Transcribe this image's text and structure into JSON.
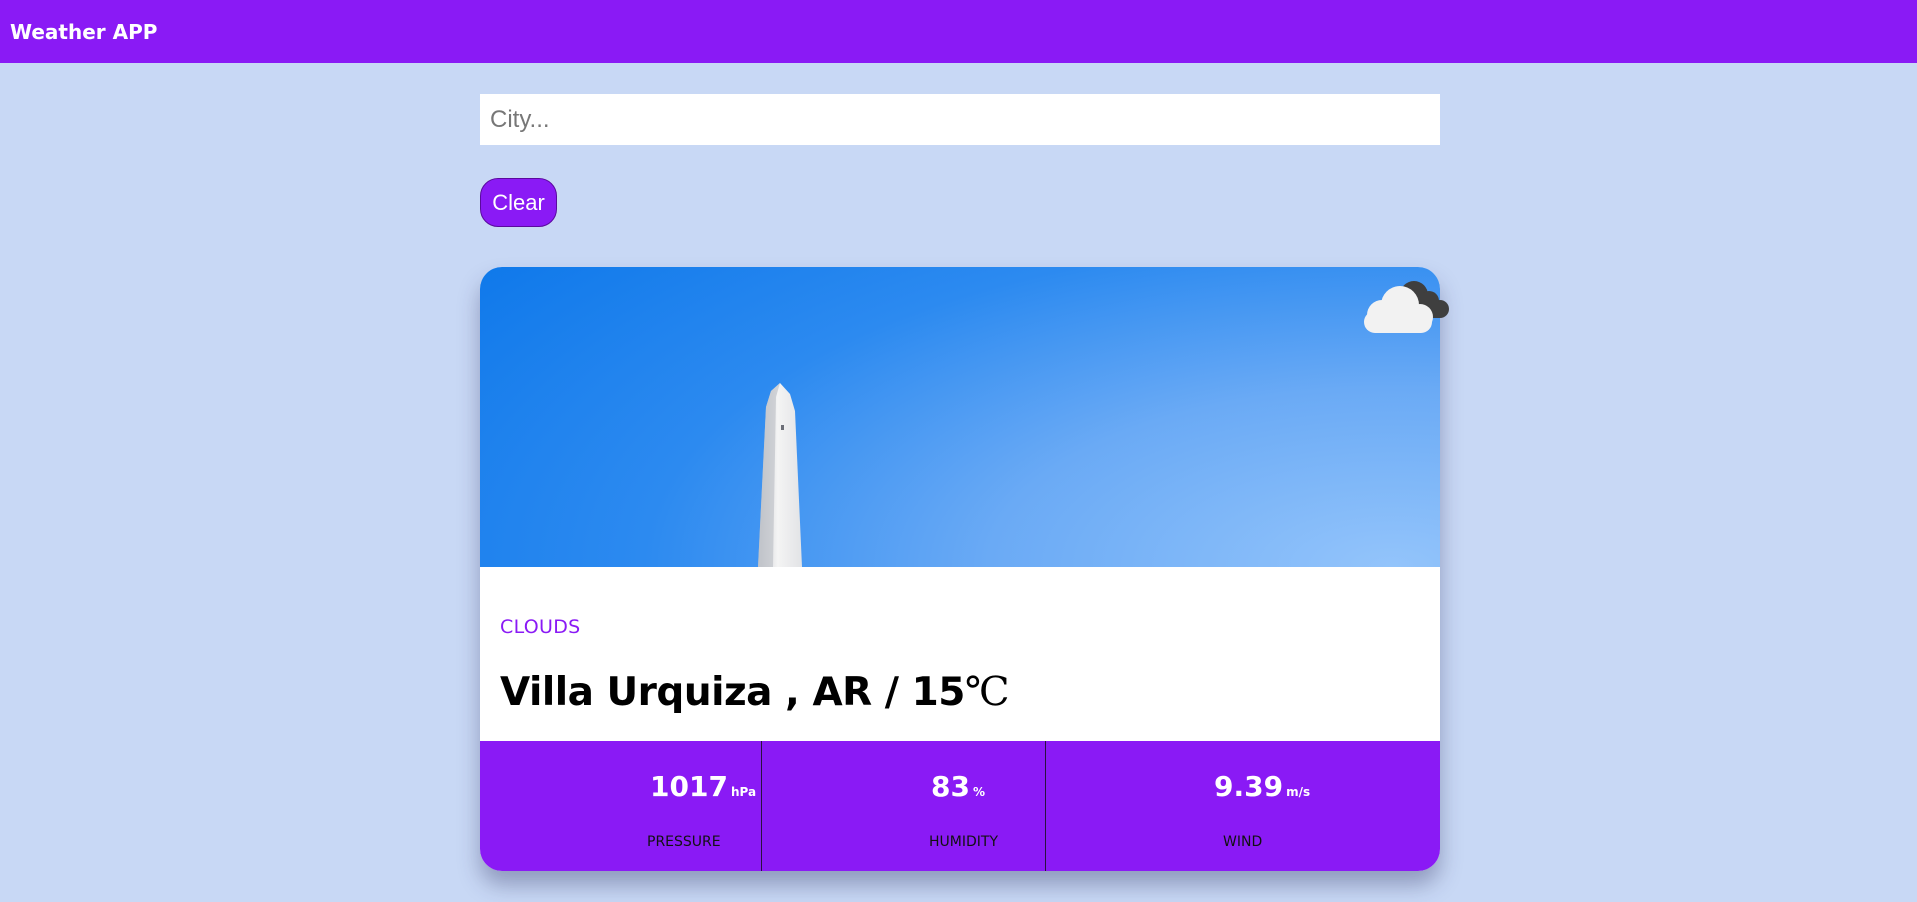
{
  "header": {
    "title": "Weather APP"
  },
  "search": {
    "placeholder": "City..."
  },
  "actions": {
    "clear_label": "Clear"
  },
  "card": {
    "icon": "cloud-icon",
    "condition": "CLOUDS",
    "city": "Villa Urquiza",
    "country": "AR",
    "temperature": "15",
    "temperature_unit": "℃",
    "stats": [
      {
        "value": "1017",
        "unit": "hPa",
        "label": "PRESSURE"
      },
      {
        "value": "83",
        "unit": "%",
        "label": "HUMIDITY"
      },
      {
        "value": "9.39",
        "unit": "m/s",
        "label": "WIND"
      }
    ]
  },
  "colors": {
    "accent": "#8a1af5",
    "background": "#c8d8f5",
    "sky": "#2c8af0"
  }
}
